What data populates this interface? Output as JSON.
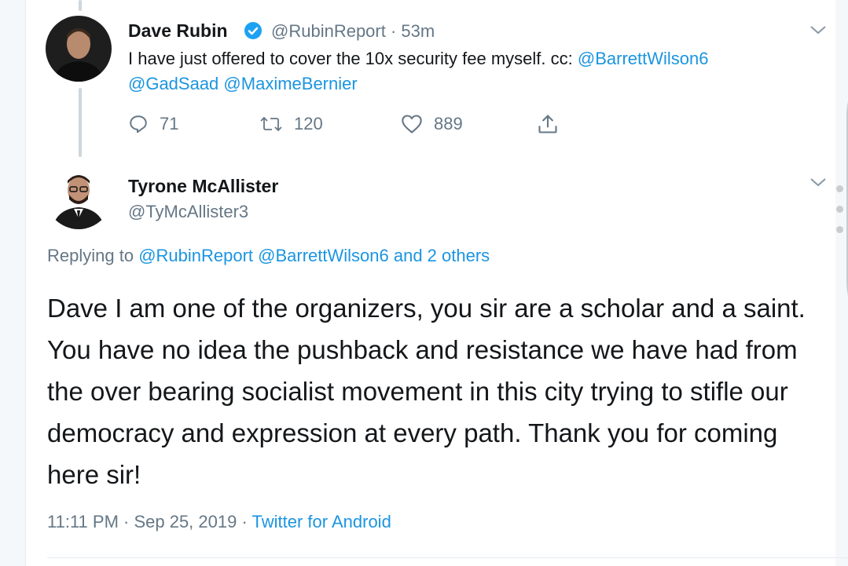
{
  "tweet1": {
    "name": "Dave Rubin",
    "handle": "@RubinReport",
    "time": "53m",
    "text_main": "I have just offered to cover the 10x security fee myself. cc: ",
    "mention1": "@BarrettWilson6",
    "mention2": "@GadSaad",
    "mention3": "@MaximeBernier",
    "replies": "71",
    "retweets": "120",
    "likes": "889"
  },
  "tweet2": {
    "name": "Tyrone McAllister",
    "handle": "@TyMcAllister3",
    "replying_prefix": "Replying to ",
    "replying_to": "@RubinReport @BarrettWilson6 and 2 others",
    "text": "Dave I am one of the organizers, you sir are a scholar and a saint. You have no idea the pushback and resistance we have had from the over bearing socialist movement in this city trying to stifle our democracy and expression at every path. Thank you for coming here sir!",
    "timestamp": "11:11 PM · Sep 25, 2019 · ",
    "source": "Twitter for Android"
  },
  "icons": {
    "verified": "verified-badge-icon",
    "chevron": "chevron-down-icon",
    "reply": "reply-icon",
    "retweet": "retweet-icon",
    "like": "heart-icon",
    "share": "share-icon"
  },
  "colors": {
    "link": "#1b95e0",
    "muted": "#657786",
    "text": "#14171a",
    "verified": "#1da1f2"
  }
}
